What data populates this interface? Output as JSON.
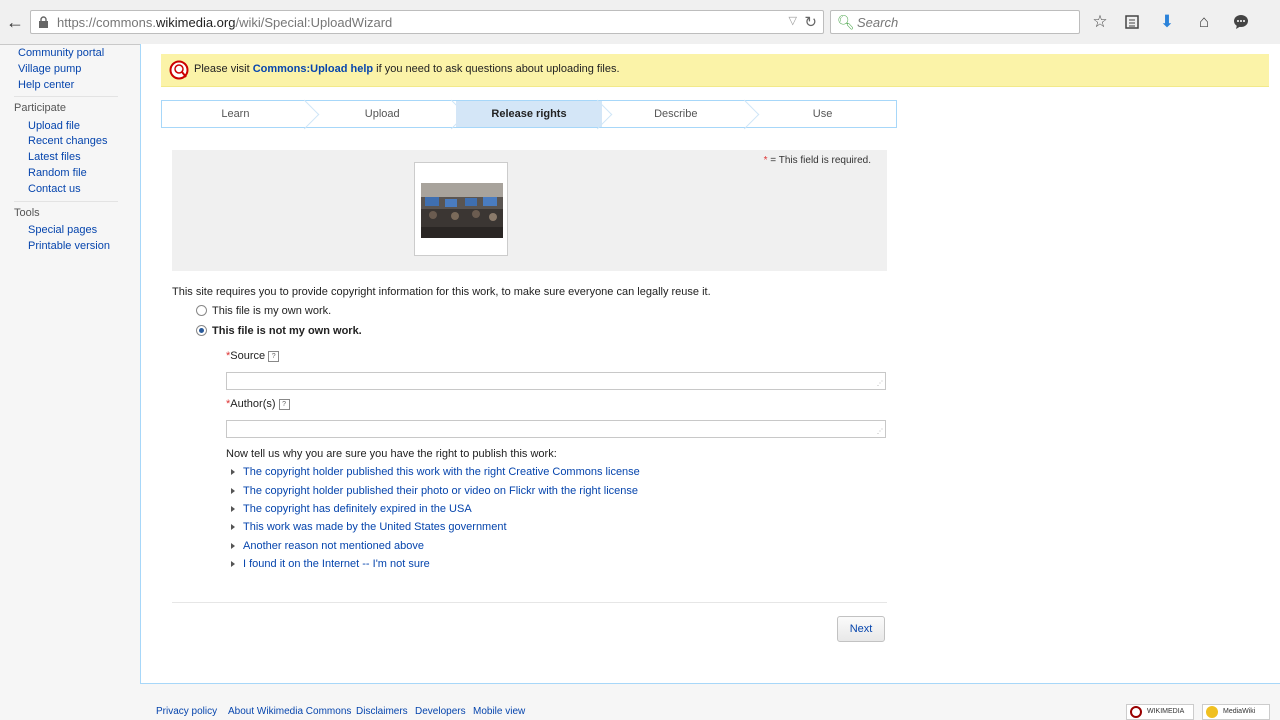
{
  "browser": {
    "url_prefix": "https://commons.",
    "url_domain": "wikimedia.org",
    "url_path": "/wiki/Special:UploadWizard",
    "search_placeholder": "Search"
  },
  "sidebar": {
    "nav_links": [
      "Community portal",
      "Village pump",
      "Help center"
    ],
    "participate_heading": "Participate",
    "participate_links": [
      "Upload file",
      "Recent changes",
      "Latest files",
      "Random file",
      "Contact us"
    ],
    "tools_heading": "Tools",
    "tools_links": [
      "Special pages",
      "Printable version"
    ]
  },
  "notice": {
    "before": "Please visit ",
    "link": "Commons:Upload help",
    "after": " if you need to ask questions about uploading files."
  },
  "steps": [
    "Learn",
    "Upload",
    "Release rights",
    "Describe",
    "Use"
  ],
  "active_step": "Release rights",
  "required_note": {
    "star": "*",
    "text": " = This field is required."
  },
  "copyright_lead": "This site requires you to provide copyright information for this work, to make sure everyone can legally reuse it.",
  "options": {
    "own_work": "This file is my own work.",
    "not_own_work": "This file is not my own work.",
    "selected": "not_own_work"
  },
  "fields": {
    "source_label": "Source",
    "source_value": "",
    "author_label": "Author(s)",
    "author_value": "",
    "required_star": "*",
    "help_glyph": "?"
  },
  "prompt": "Now tell us why you are sure you have the right to publish this work:",
  "reasons": [
    "The copyright holder published this work with the right Creative Commons license",
    "The copyright holder published their photo or video on Flickr with the right license",
    "The copyright has definitely expired in the USA",
    "This work was made by the United States government",
    "Another reason not mentioned above",
    "I found it on the Internet -- I'm not sure"
  ],
  "next_label": "Next",
  "footer": {
    "links": [
      "Privacy policy",
      "About Wikimedia Commons",
      "Disclaimers",
      "Developers",
      "Mobile view"
    ],
    "badge_wikimedia": "WIKIMEDIA",
    "badge_mediawiki": "MediaWiki"
  },
  "colors": {
    "link": "#0645ad",
    "notice_bg": "#fbf3a8",
    "active_step_bg": "#d4e6f7",
    "border_blue": "#a7d7f9"
  }
}
